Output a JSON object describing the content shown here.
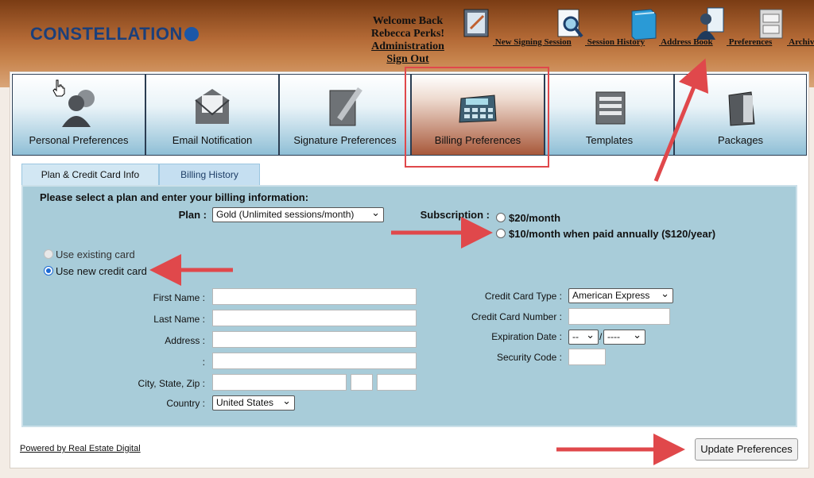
{
  "brand": {
    "logo_text": "CONSTELLATION"
  },
  "welcome": {
    "line1": "Welcome Back",
    "line2": "Rebecca Perks!",
    "admin": "Administration",
    "signout": "Sign Out"
  },
  "nav": {
    "items": [
      {
        "label": "New Signing Session",
        "icon": "signing-session-icon"
      },
      {
        "label": "Session History",
        "icon": "magnifier-doc-icon"
      },
      {
        "label": "Address Book",
        "icon": "book-icon"
      },
      {
        "label": "Preferences",
        "icon": "person-settings-icon"
      },
      {
        "label": "Archives",
        "icon": "filing-cabinet-icon"
      }
    ]
  },
  "tabs": [
    {
      "label": "Personal Preferences",
      "icon": "people-icon"
    },
    {
      "label": "Email Notification",
      "icon": "envelope-icon"
    },
    {
      "label": "Signature Preferences",
      "icon": "pen-doc-icon"
    },
    {
      "label": "Billing Preferences",
      "icon": "calculator-icon",
      "active": true
    },
    {
      "label": "Templates",
      "icon": "stack-docs-icon"
    },
    {
      "label": "Packages",
      "icon": "package-icon"
    }
  ],
  "subtabs": [
    {
      "label": "Plan & Credit Card Info"
    },
    {
      "label": "Billing History"
    }
  ],
  "form": {
    "heading": "Please select a plan and enter your billing information:",
    "plan_label": "Plan :",
    "plan_value": "Gold (Unlimited sessions/month)",
    "subscription_label": "Subscription :",
    "sub_opt1": "$20/month",
    "sub_opt2": "$10/month when paid annually ($120/year)",
    "card_existing": "Use existing card",
    "card_new": "Use new credit card",
    "first_name": "First Name :",
    "last_name": "Last Name :",
    "address": "Address :",
    "address2": ":",
    "city_state_zip": "City, State, Zip :",
    "country_label": "Country :",
    "country_value": "United States",
    "cc_type_label": "Credit Card Type :",
    "cc_type_value": "American Express",
    "cc_number_label": "Credit Card Number :",
    "exp_label": "Expiration Date :",
    "exp_month": "--",
    "exp_sep": "/",
    "exp_year": "----",
    "security_label": "Security Code :"
  },
  "footer": {
    "powered": "Powered by Real Estate Digital",
    "update_button": "Update Preferences"
  },
  "colors": {
    "accent_red": "#e0484b",
    "form_bg": "#a8ccd9",
    "header_brown": "#b46a36"
  }
}
